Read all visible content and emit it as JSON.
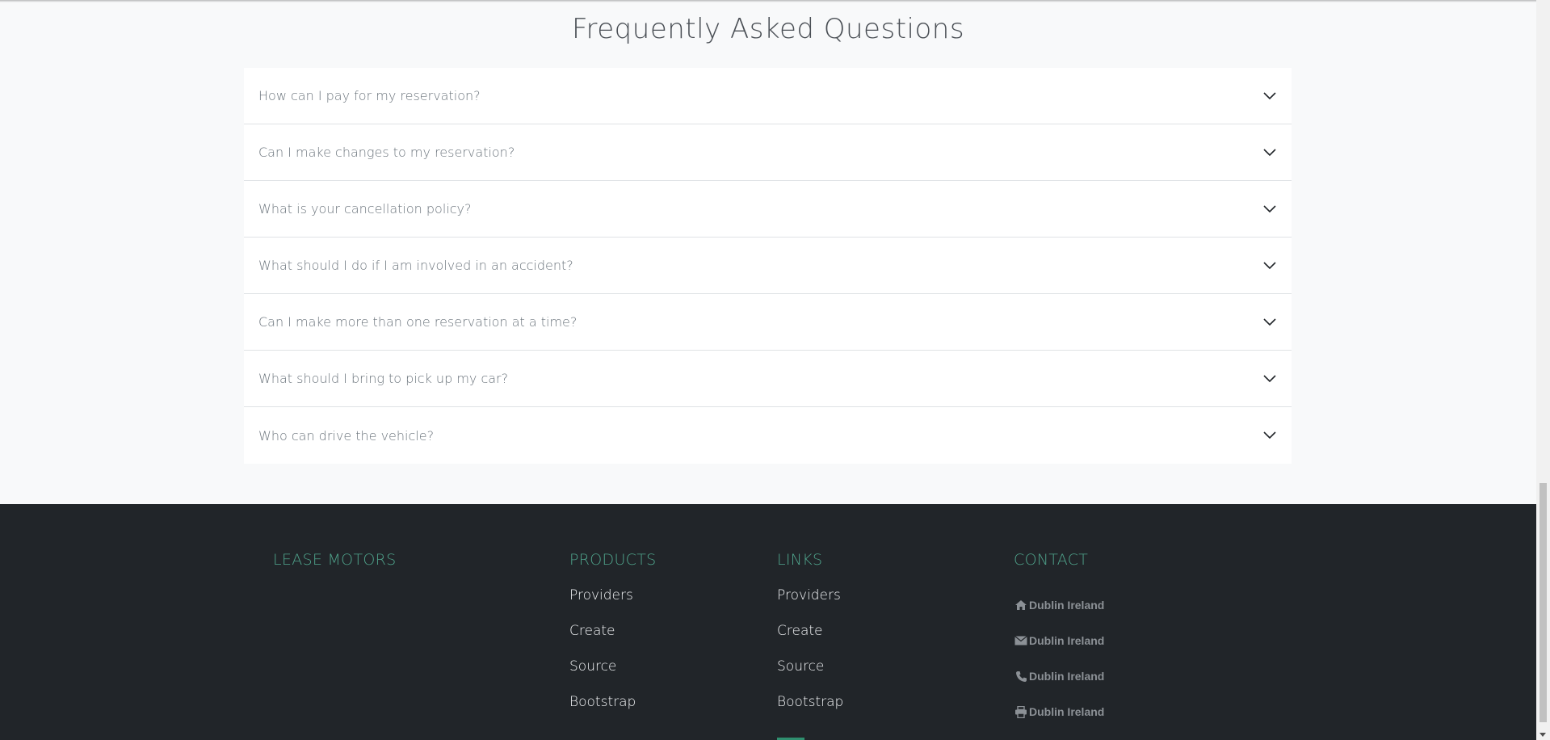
{
  "faq": {
    "title": "Frequently Asked Questions",
    "items": [
      {
        "question": "How can I pay for my reservation?"
      },
      {
        "question": "Can I make changes to my reservation?"
      },
      {
        "question": "What is your cancellation policy?"
      },
      {
        "question": "What should I do if I am involved in an accident?"
      },
      {
        "question": "Can I make more than one reservation at a time?"
      },
      {
        "question": "What should I bring to pick up my car?"
      },
      {
        "question": "Who can drive the vehicle?"
      }
    ]
  },
  "footer": {
    "brand": "LEASE MOTORS",
    "products": {
      "heading": "PRODUCTS",
      "links": [
        "Providers",
        "Create",
        "Source",
        "Bootstrap"
      ]
    },
    "links": {
      "heading": "LINKS",
      "links": [
        "Providers",
        "Create",
        "Source",
        "Bootstrap"
      ]
    },
    "contact": {
      "heading": "CONTACT",
      "items": [
        {
          "icon": "home-icon",
          "text": "Dublin Ireland"
        },
        {
          "icon": "envelope-icon",
          "text": "Dublin Ireland"
        },
        {
          "icon": "phone-icon",
          "text": "Dublin Ireland"
        },
        {
          "icon": "print-icon",
          "text": "Dublin Ireland"
        }
      ]
    }
  },
  "colors": {
    "accent": "#4fa38b",
    "footer_bg": "#212529",
    "page_bg": "#f8f9fa"
  }
}
